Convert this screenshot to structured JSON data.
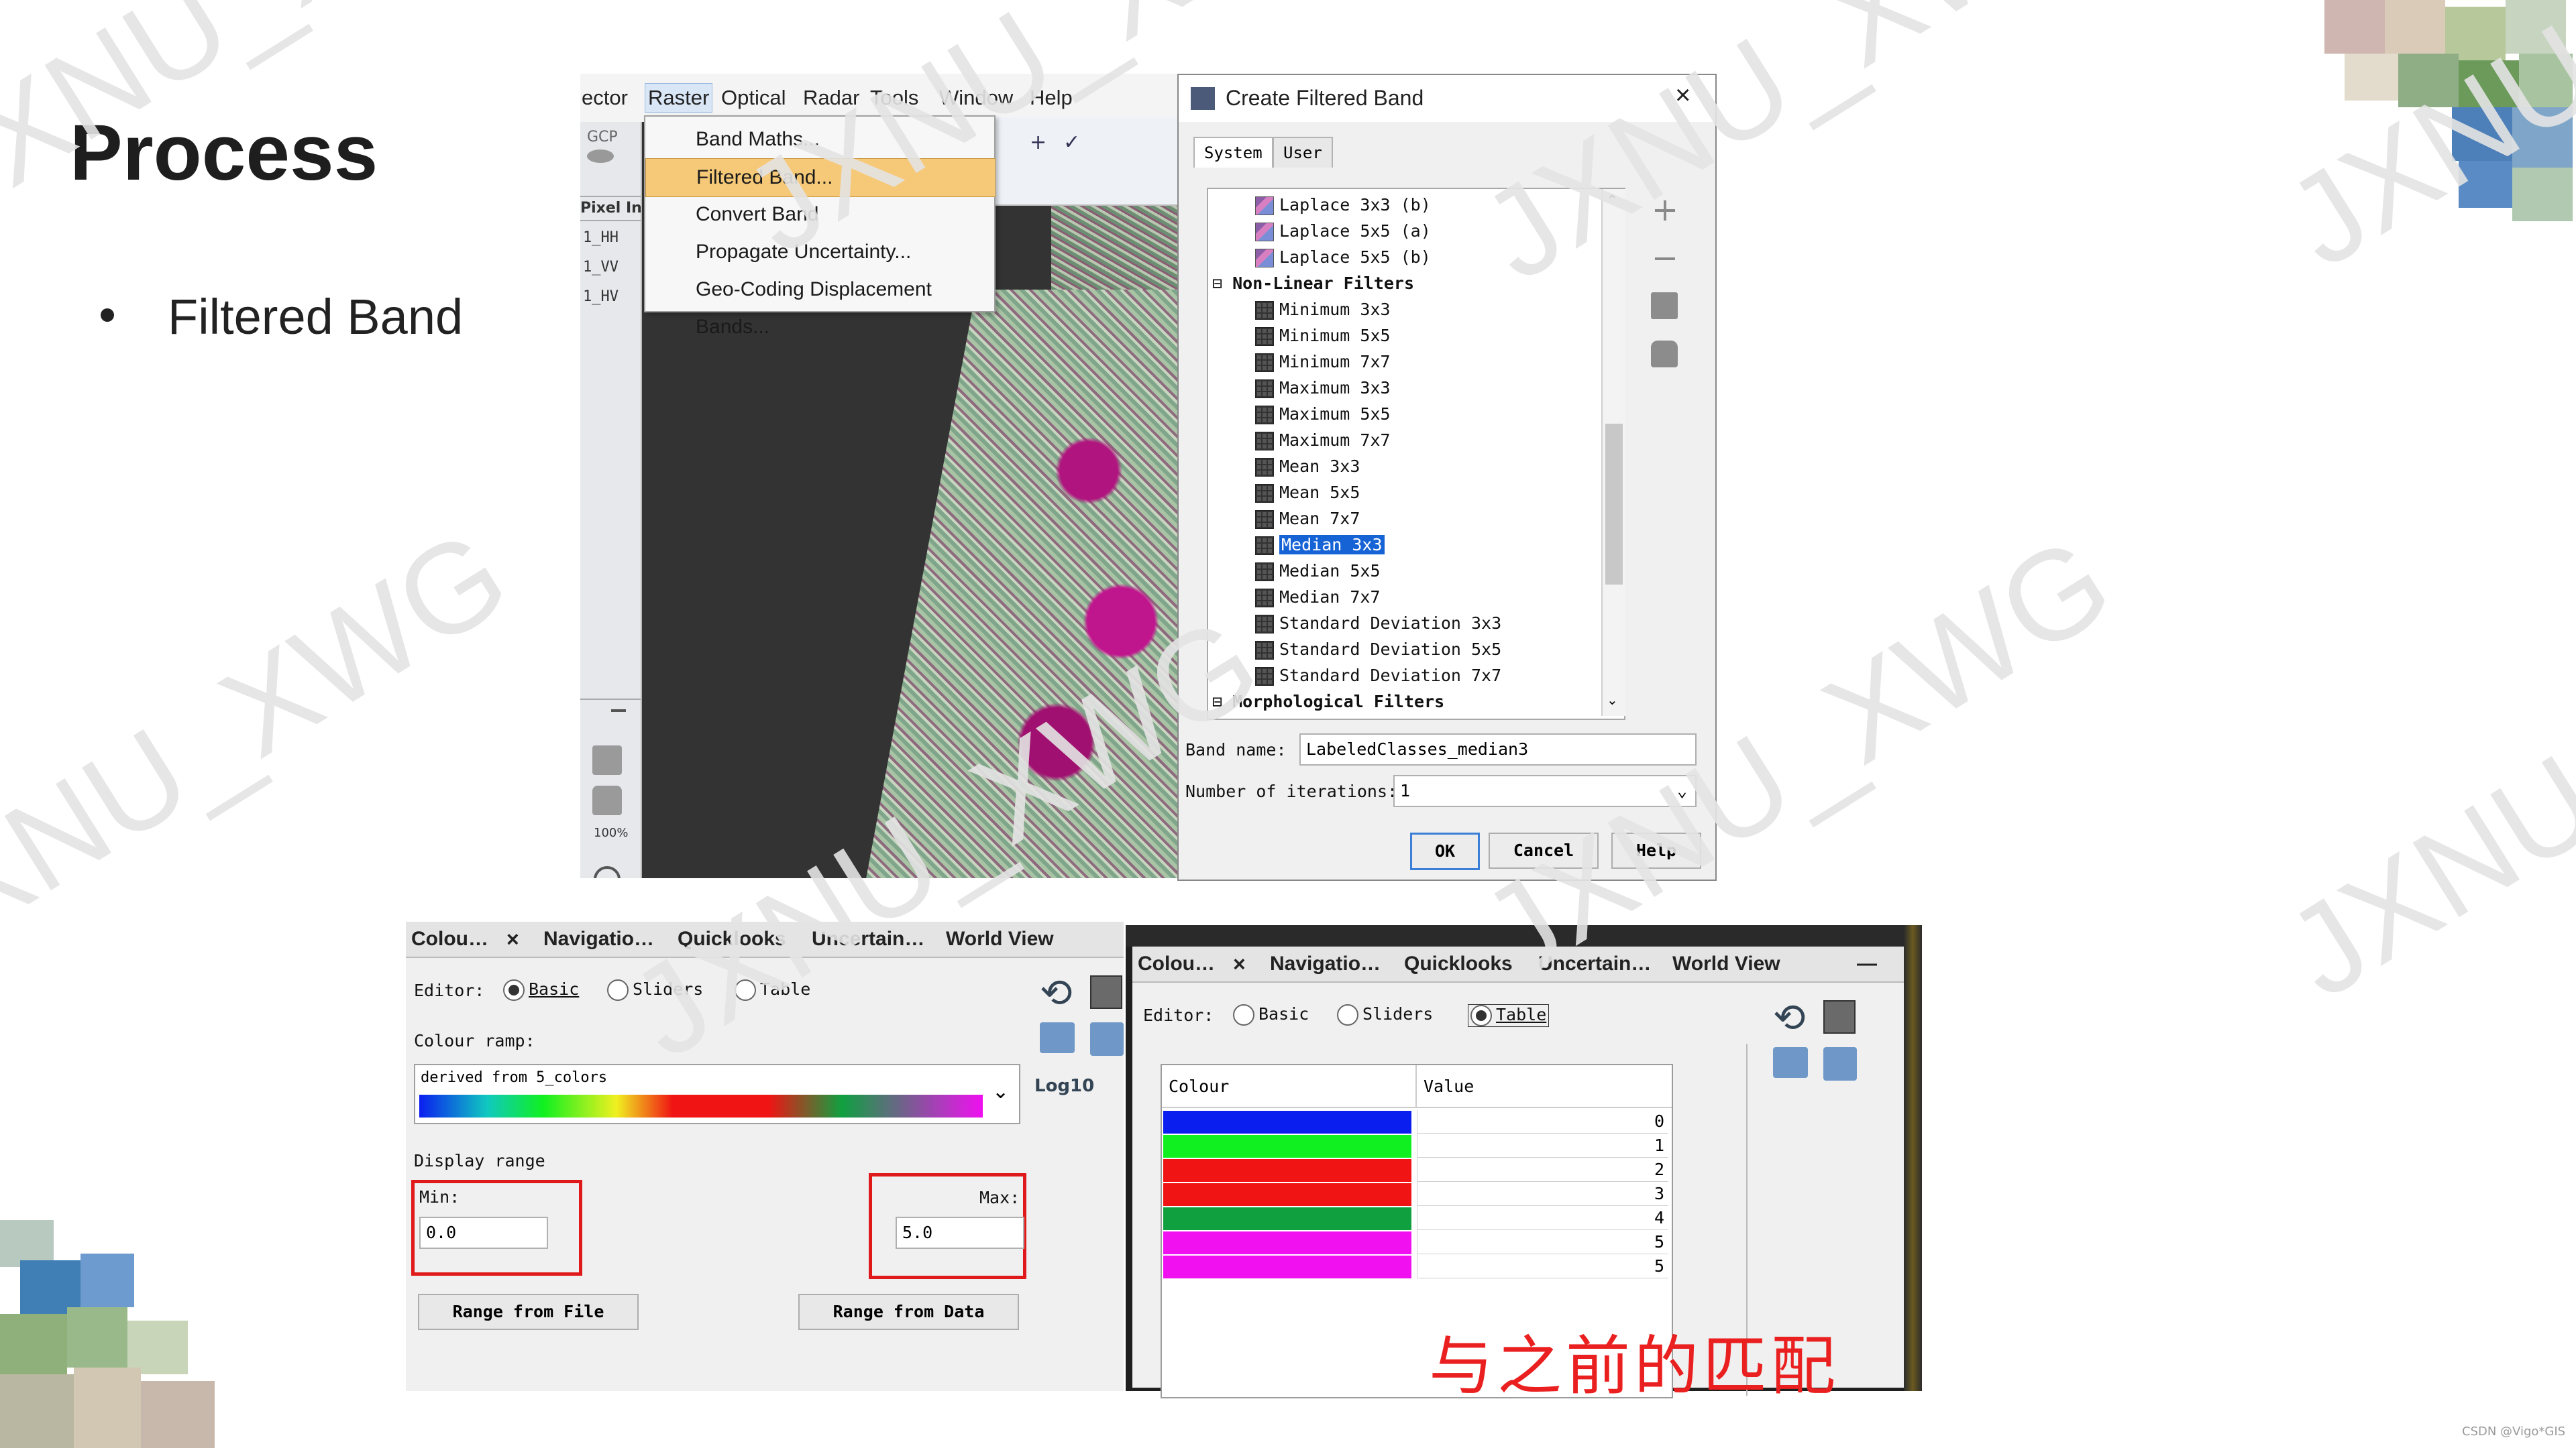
{
  "slide": {
    "title": "Process",
    "bullet": "Filtered Band",
    "credit": "CSDN @Vigo*GIS"
  },
  "watermarks": [
    "JXNU_XWG",
    "JXNU_XWG",
    "JXNU_XWG",
    "JXNU_XWG",
    "JXNU_XWG",
    "JXNU_XWG",
    "JXNU_XWG",
    "JXNU_XWG"
  ],
  "menu_screenshot": {
    "menubar": [
      "ector",
      "Raster",
      "Optical",
      "Radar",
      "Tools",
      "Window",
      "Help"
    ],
    "left_header": "GCP",
    "pixel_label": "Pixel In",
    "bands": [
      "1_HH",
      "1_VV",
      "1_HV"
    ],
    "zoom": "100%",
    "dropdown": [
      "Band Maths...",
      "Filtered Band...",
      "Convert Band",
      "Propagate Uncertainty...",
      "Geo-Coding Displacement Bands..."
    ],
    "selected_item": "Filtered Band..."
  },
  "filter_dialog": {
    "title": "Create Filtered Band",
    "tabs": [
      "System",
      "User"
    ],
    "tree_items": [
      {
        "label": "Laplace 3x3  (b)",
        "kind": "item"
      },
      {
        "label": "Laplace 5x5  (a)",
        "kind": "item"
      },
      {
        "label": "Laplace 5x5  (b)",
        "kind": "item"
      },
      {
        "label": "Non-Linear Filters",
        "kind": "group"
      },
      {
        "label": "Minimum 3x3",
        "kind": "item"
      },
      {
        "label": "Minimum 5x5",
        "kind": "item"
      },
      {
        "label": "Minimum 7x7",
        "kind": "item"
      },
      {
        "label": "Maximum 3x3",
        "kind": "item"
      },
      {
        "label": "Maximum 5x5",
        "kind": "item"
      },
      {
        "label": "Maximum 7x7",
        "kind": "item"
      },
      {
        "label": "Mean 3x3",
        "kind": "item"
      },
      {
        "label": "Mean 5x5",
        "kind": "item"
      },
      {
        "label": "Mean 7x7",
        "kind": "item"
      },
      {
        "label": "Median 3x3",
        "kind": "item",
        "selected": true
      },
      {
        "label": "Median 5x5",
        "kind": "item"
      },
      {
        "label": "Median 7x7",
        "kind": "item"
      },
      {
        "label": "Standard Deviation 3x3",
        "kind": "item"
      },
      {
        "label": "Standard Deviation 5x5",
        "kind": "item"
      },
      {
        "label": "Standard Deviation 7x7",
        "kind": "item"
      },
      {
        "label": "Morphological Filters",
        "kind": "group"
      }
    ],
    "band_name_label": "Band name:",
    "band_name_value": "LabeledClasses_median3",
    "iterations_label": "Number of iterations:",
    "iterations_value": "1",
    "buttons": {
      "ok": "OK",
      "cancel": "Cancel",
      "help": "Help"
    }
  },
  "colour_basic": {
    "tabs": [
      "Colou…",
      "Navigatio…",
      "Quicklooks",
      "Uncertain…",
      "World View"
    ],
    "editor_label": "Editor:",
    "editor_options": [
      "Basic",
      "Sliders",
      "Table"
    ],
    "editor_selected": "Basic",
    "ramp_label": "Colour ramp:",
    "ramp_value": "derived from 5_colors",
    "log_label": "Log10",
    "display_range_label": "Display range",
    "min_label": "Min:",
    "min_value": "0.0",
    "max_label": "Max:",
    "max_value": "5.0",
    "range_file_button": "Range from File",
    "range_data_button": "Range from Data"
  },
  "colour_table": {
    "tabs": [
      "Colou…",
      "Navigatio…",
      "Quicklooks",
      "Uncertain…",
      "World View"
    ],
    "editor_label": "Editor:",
    "editor_options": [
      "Basic",
      "Sliders",
      "Table"
    ],
    "editor_selected": "Table",
    "col_colour": "Colour",
    "col_value": "Value",
    "rows": [
      {
        "color": "#0a1ef0",
        "value": "0"
      },
      {
        "color": "#10f020",
        "value": "1"
      },
      {
        "color": "#f01414",
        "value": "2"
      },
      {
        "color": "#f01414",
        "value": "3"
      },
      {
        "color": "#10a040",
        "value": "4"
      },
      {
        "color": "#f010f0",
        "value": "5"
      },
      {
        "color": "#f010f0",
        "value": "5"
      }
    ],
    "note": "与之前的匹配"
  },
  "colors": {
    "accent_red": "#e01a1a",
    "selection_blue": "#1663d6",
    "menu_highlight": "#f6c978"
  }
}
